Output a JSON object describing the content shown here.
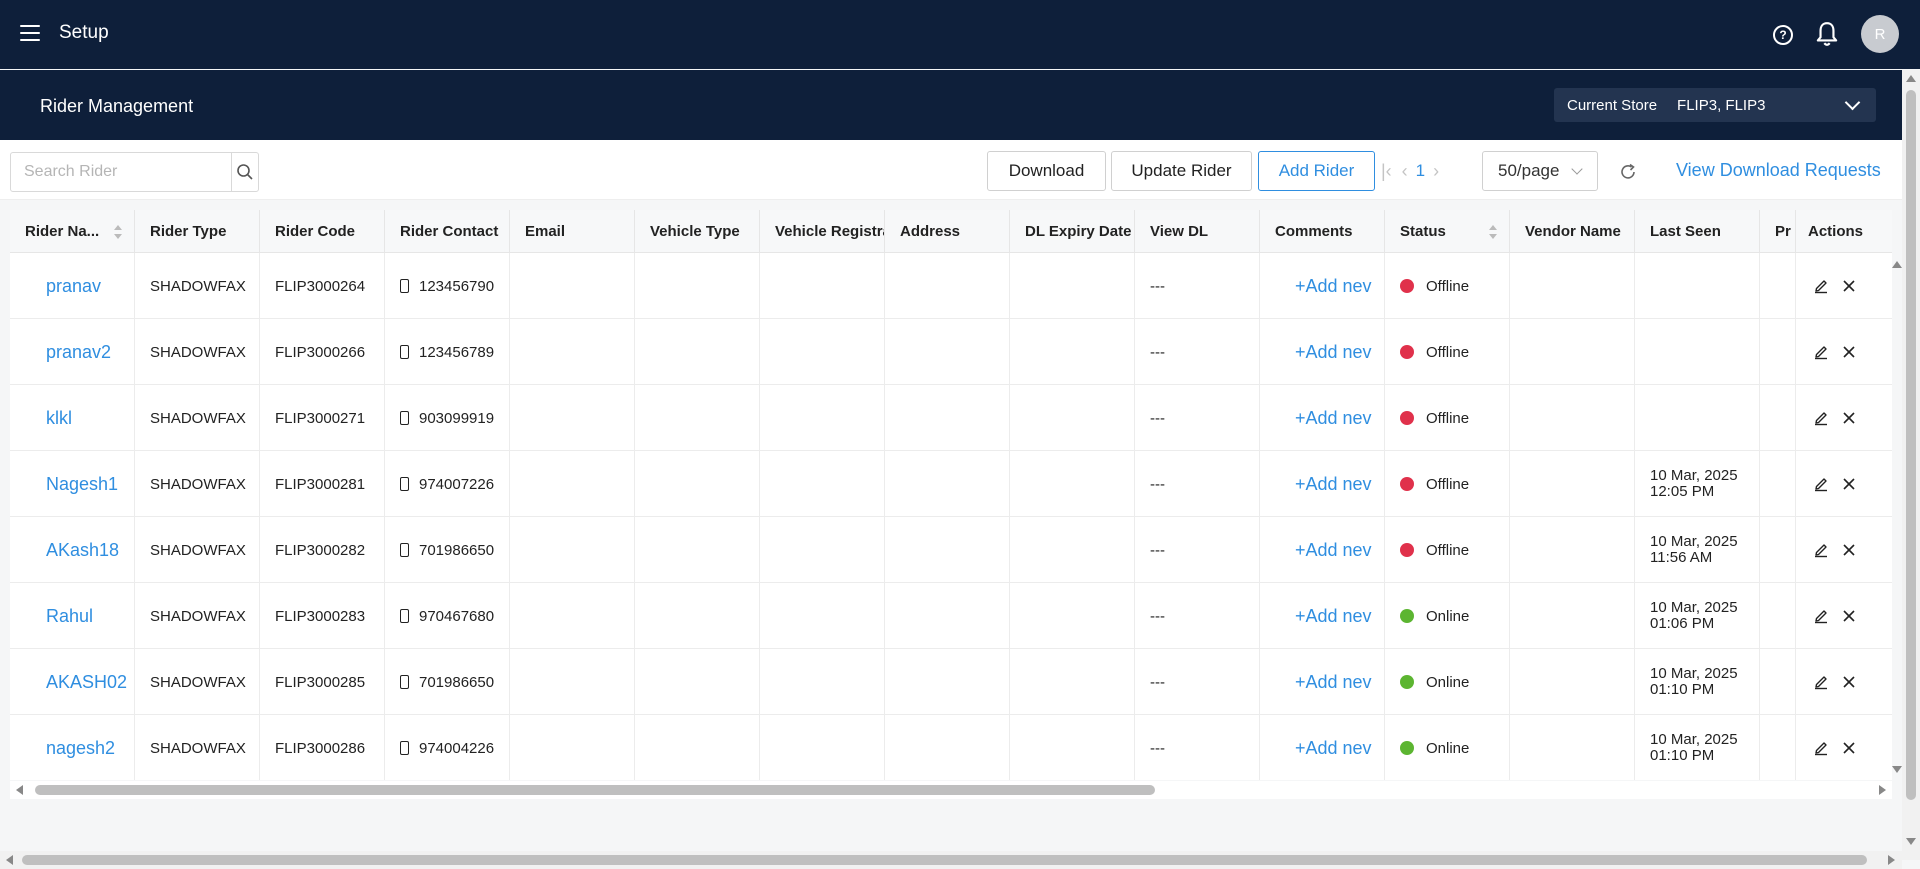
{
  "topbar": {
    "title": "Setup",
    "avatar_initial": "R",
    "icons": [
      "hamburger-icon",
      "help-icon",
      "bell-icon"
    ]
  },
  "subheader": {
    "page_title": "Rider Management",
    "store_label": "Current Store",
    "store_value": "FLIP3, FLIP3"
  },
  "toolbar": {
    "search_placeholder": "Search Rider",
    "download_label": "Download",
    "update_label": "Update Rider",
    "add_label": "Add Rider",
    "page_number": "1",
    "page_size": "50/page",
    "view_requests_label": "View Download Requests"
  },
  "table": {
    "columns": [
      "Rider Na...",
      "Rider Type",
      "Rider Code",
      "Rider Contact",
      "Email",
      "Vehicle Type",
      "Vehicle Registrat",
      "Address",
      "DL Expiry Date",
      "View DL",
      "Comments",
      "Status",
      "Vendor Name",
      "Last Seen",
      "Pr",
      "Actions"
    ],
    "rows": [
      {
        "name": "pranav",
        "type": "SHADOWFAX",
        "code": "FLIP3000264",
        "contact": "123456790",
        "view_dl": "---",
        "comment": "+Add nev",
        "status": "Offline",
        "last_seen_date": "",
        "last_seen_time": ""
      },
      {
        "name": "pranav2",
        "type": "SHADOWFAX",
        "code": "FLIP3000266",
        "contact": "123456789",
        "view_dl": "---",
        "comment": "+Add nev",
        "status": "Offline",
        "last_seen_date": "",
        "last_seen_time": ""
      },
      {
        "name": "klkl",
        "type": "SHADOWFAX",
        "code": "FLIP3000271",
        "contact": "903099919",
        "view_dl": "---",
        "comment": "+Add nev",
        "status": "Offline",
        "last_seen_date": "",
        "last_seen_time": ""
      },
      {
        "name": "Nagesh1",
        "type": "SHADOWFAX",
        "code": "FLIP3000281",
        "contact": "974007226",
        "view_dl": "---",
        "comment": "+Add nev",
        "status": "Offline",
        "last_seen_date": "10 Mar, 2025",
        "last_seen_time": "12:05 PM"
      },
      {
        "name": "AKash18",
        "type": "SHADOWFAX",
        "code": "FLIP3000282",
        "contact": "701986650",
        "view_dl": "---",
        "comment": "+Add nev",
        "status": "Offline",
        "last_seen_date": "10 Mar, 2025",
        "last_seen_time": "11:56 AM"
      },
      {
        "name": "Rahul",
        "type": "SHADOWFAX",
        "code": "FLIP3000283",
        "contact": "970467680",
        "view_dl": "---",
        "comment": "+Add nev",
        "status": "Online",
        "last_seen_date": "10 Mar, 2025",
        "last_seen_time": "01:06 PM"
      },
      {
        "name": "AKASH02",
        "type": "SHADOWFAX",
        "code": "FLIP3000285",
        "contact": "701986650",
        "view_dl": "---",
        "comment": "+Add nev",
        "status": "Online",
        "last_seen_date": "10 Mar, 2025",
        "last_seen_time": "01:10 PM"
      },
      {
        "name": "nagesh2",
        "type": "SHADOWFAX",
        "code": "FLIP3000286",
        "contact": "974004226",
        "view_dl": "---",
        "comment": "+Add nev",
        "status": "Online",
        "last_seen_date": "10 Mar, 2025",
        "last_seen_time": "01:10 PM"
      }
    ]
  },
  "colors": {
    "header_bg": "#0e1f3a",
    "accent": "#2f8ee0",
    "offline": "#e0314b",
    "online": "#5cb531"
  }
}
